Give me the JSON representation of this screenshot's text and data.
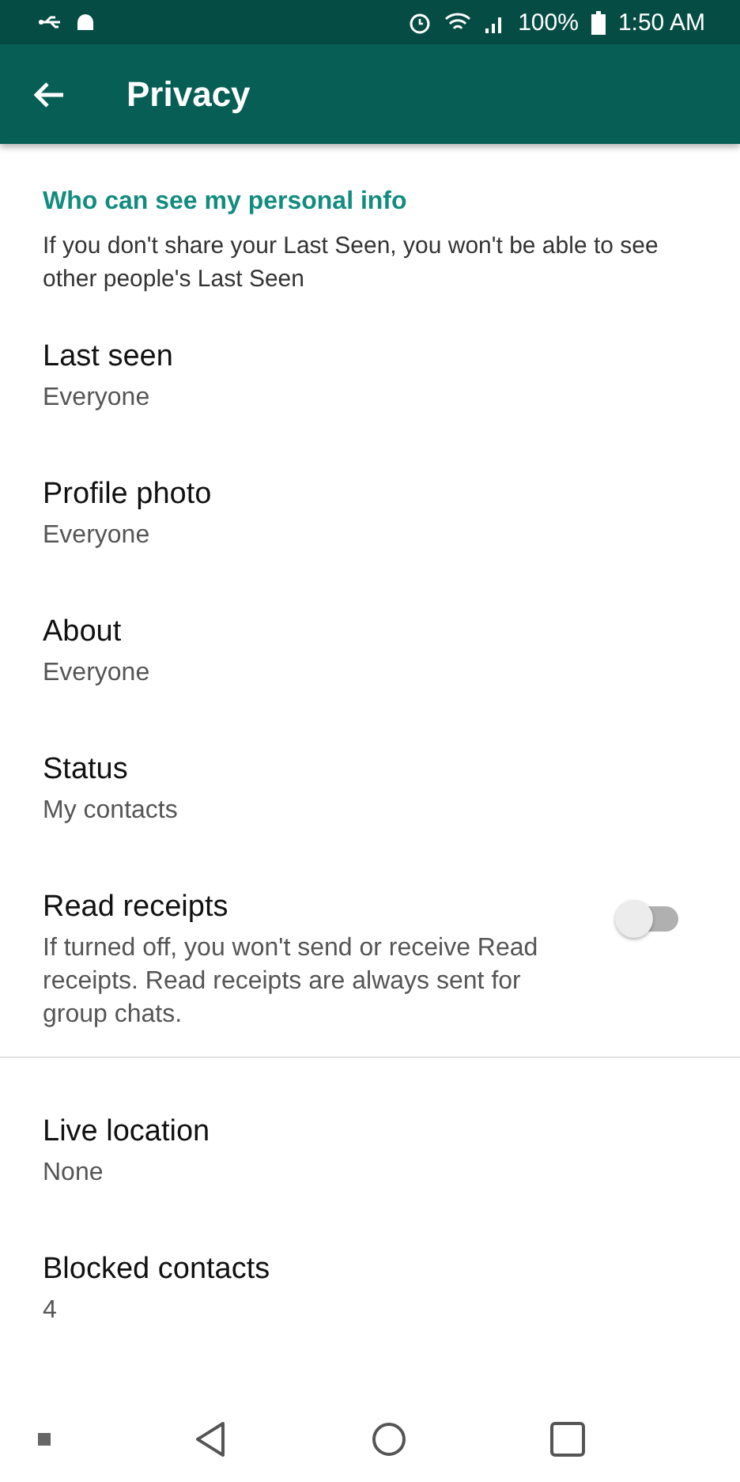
{
  "status_bar": {
    "battery": "100%",
    "time": "1:50 AM"
  },
  "app_bar": {
    "title": "Privacy"
  },
  "sections": [
    {
      "header": "Who can see my personal info",
      "description": "If you don't share your Last Seen, you won't be able to see other people's Last Seen",
      "items": [
        {
          "kind": "setting",
          "title": "Last seen",
          "value": "Everyone"
        },
        {
          "kind": "setting",
          "title": "Profile photo",
          "value": "Everyone"
        },
        {
          "kind": "setting",
          "title": "About",
          "value": "Everyone"
        },
        {
          "kind": "setting",
          "title": "Status",
          "value": "My contacts"
        },
        {
          "kind": "toggle",
          "title": "Read receipts",
          "value": "If turned off, you won't send or receive Read receipts. Read receipts are always sent for group chats.",
          "on": false
        }
      ]
    },
    {
      "items": [
        {
          "kind": "setting",
          "title": "Live location",
          "value": "None"
        },
        {
          "kind": "setting",
          "title": "Blocked contacts",
          "value": "4"
        }
      ]
    }
  ]
}
